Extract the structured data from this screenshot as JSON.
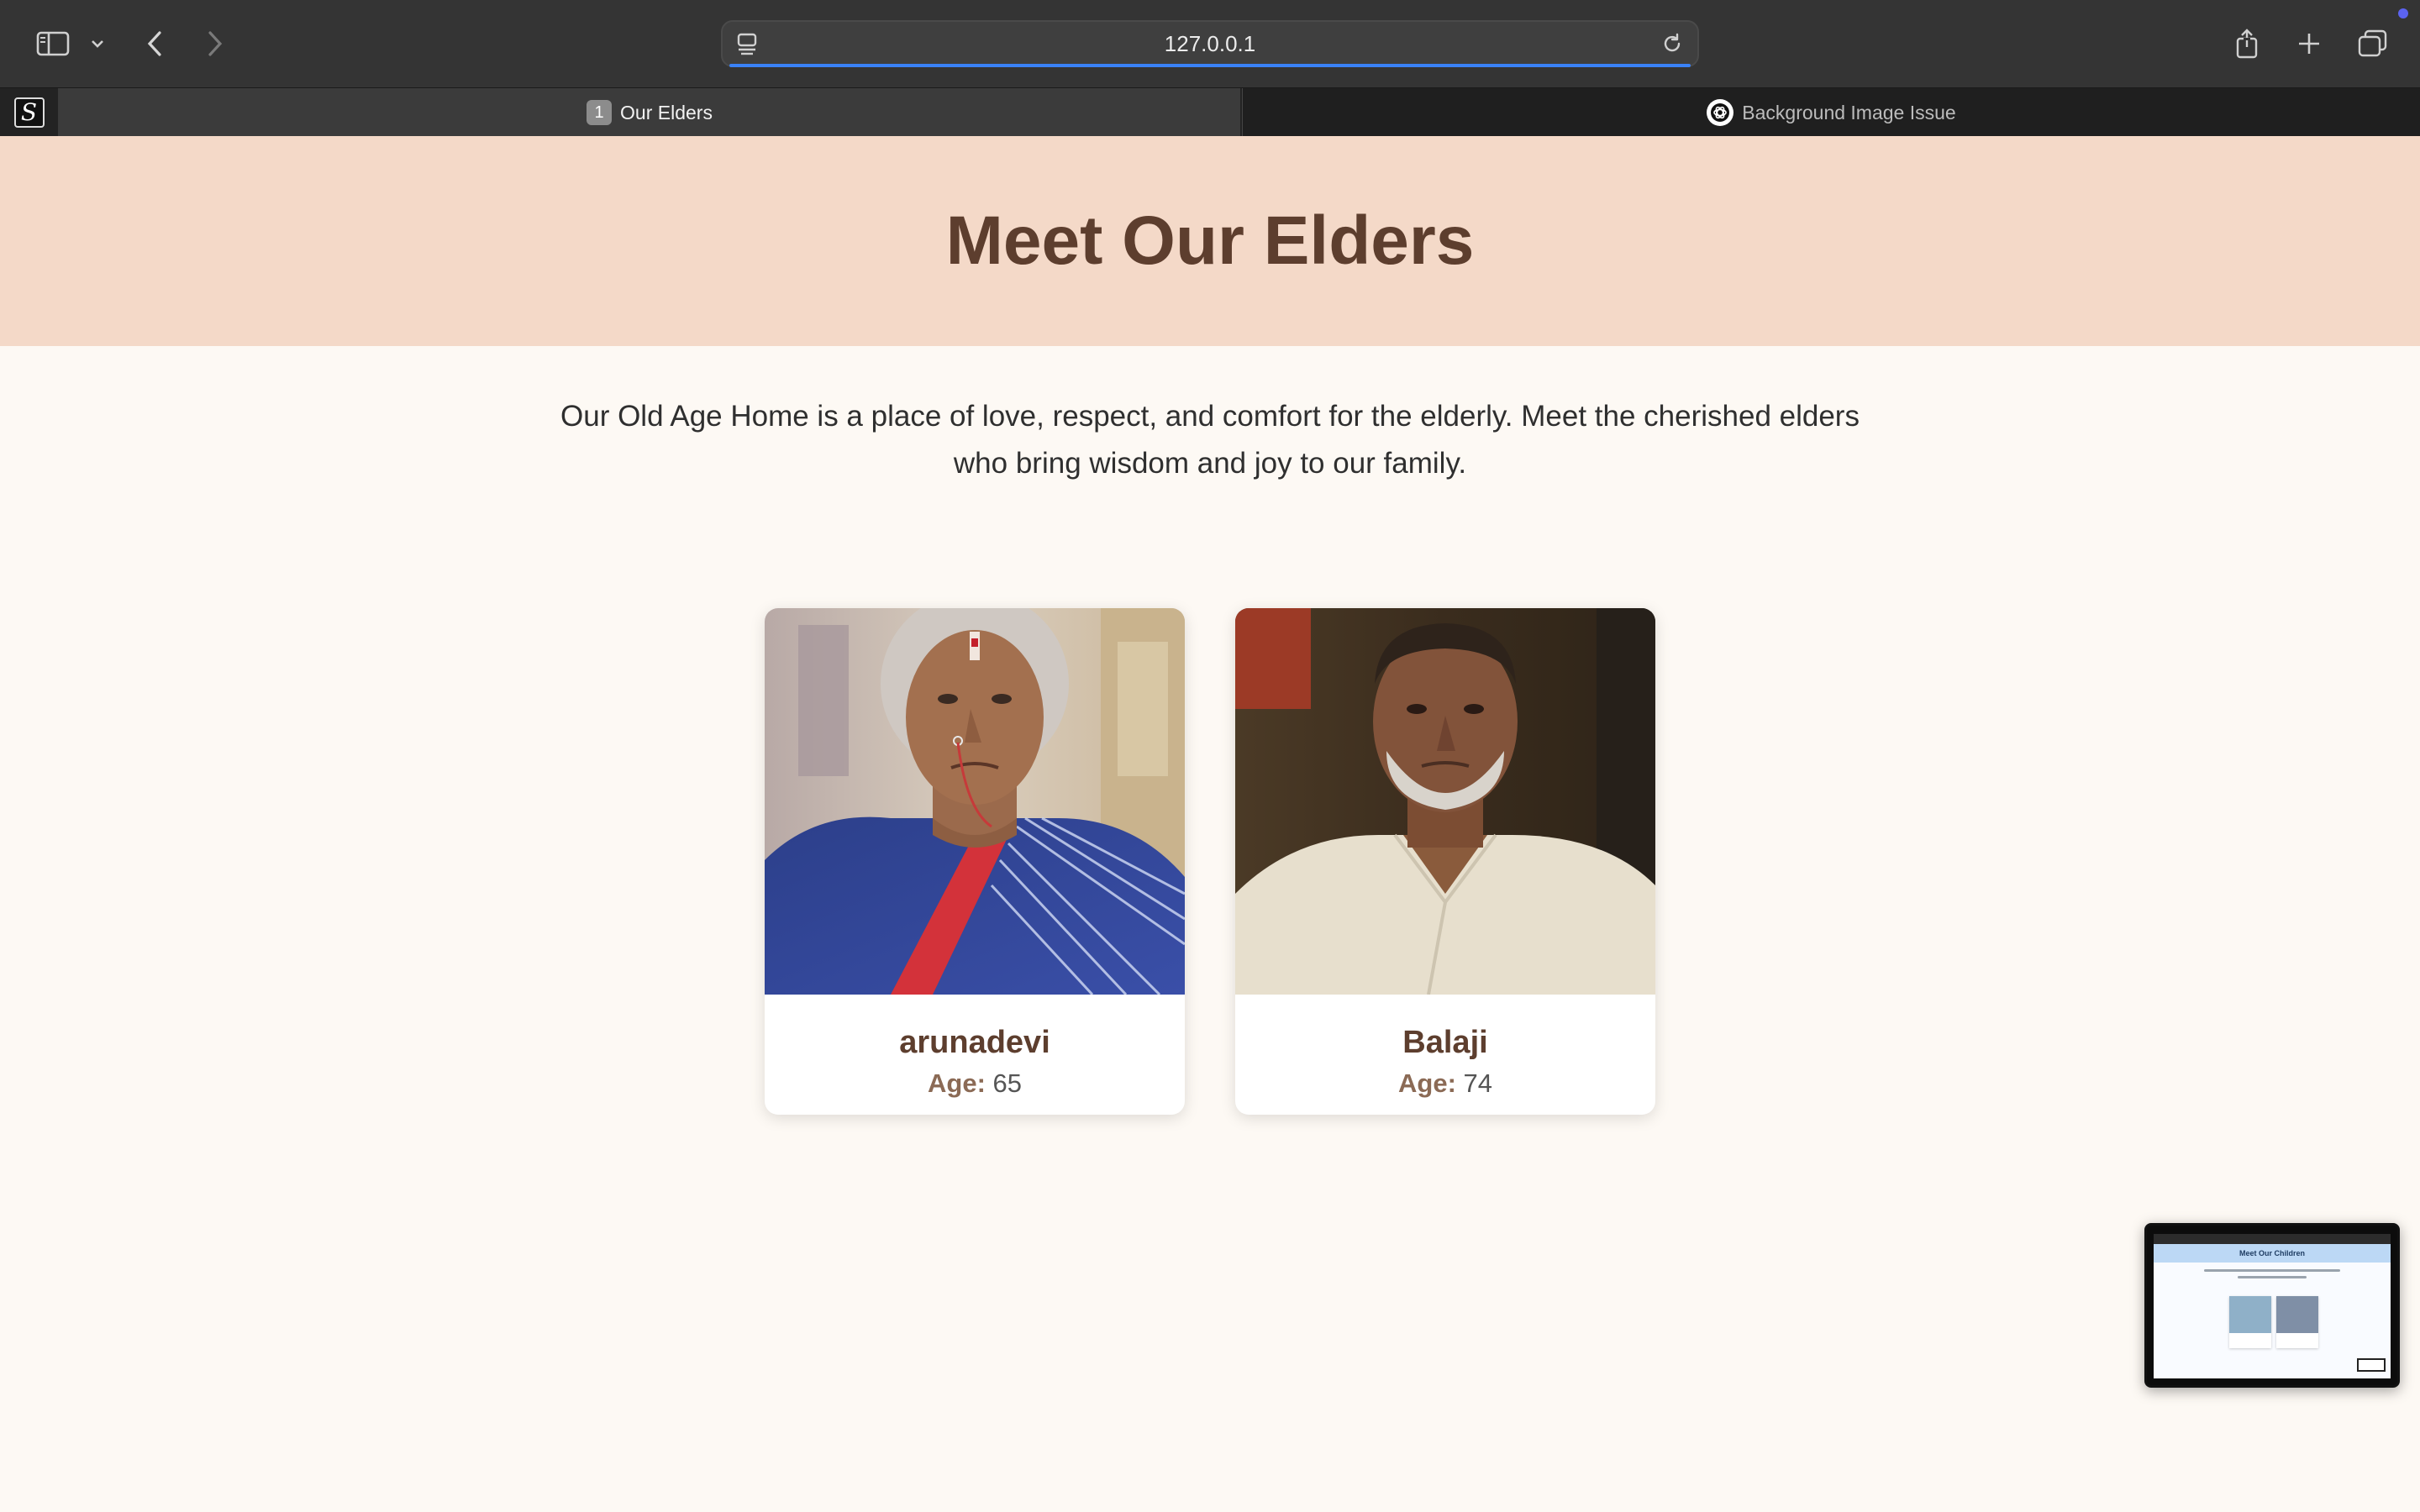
{
  "browser": {
    "url": "127.0.0.1",
    "tabs": [
      {
        "number": "1",
        "title": "Our Elders",
        "active": true
      },
      {
        "title": "Background Image Issue",
        "active": false
      }
    ],
    "accent_color": "#3a82f7"
  },
  "page": {
    "title": "Meet Our Elders",
    "intro": "Our Old Age Home is a place of love, respect, and comfort for the elderly. Meet the cherished elders who bring wisdom and joy to our family.",
    "colors": {
      "hero_bg": "#f4d9c8",
      "heading": "#5d3e2e",
      "page_bg": "#fdf9f4"
    },
    "elders": [
      {
        "name": "arunadevi",
        "age_label": "Age:",
        "age": "65"
      },
      {
        "name": "Balaji",
        "age_label": "Age:",
        "age": "74"
      }
    ]
  },
  "preview": {
    "title": "Meet Our Children"
  }
}
